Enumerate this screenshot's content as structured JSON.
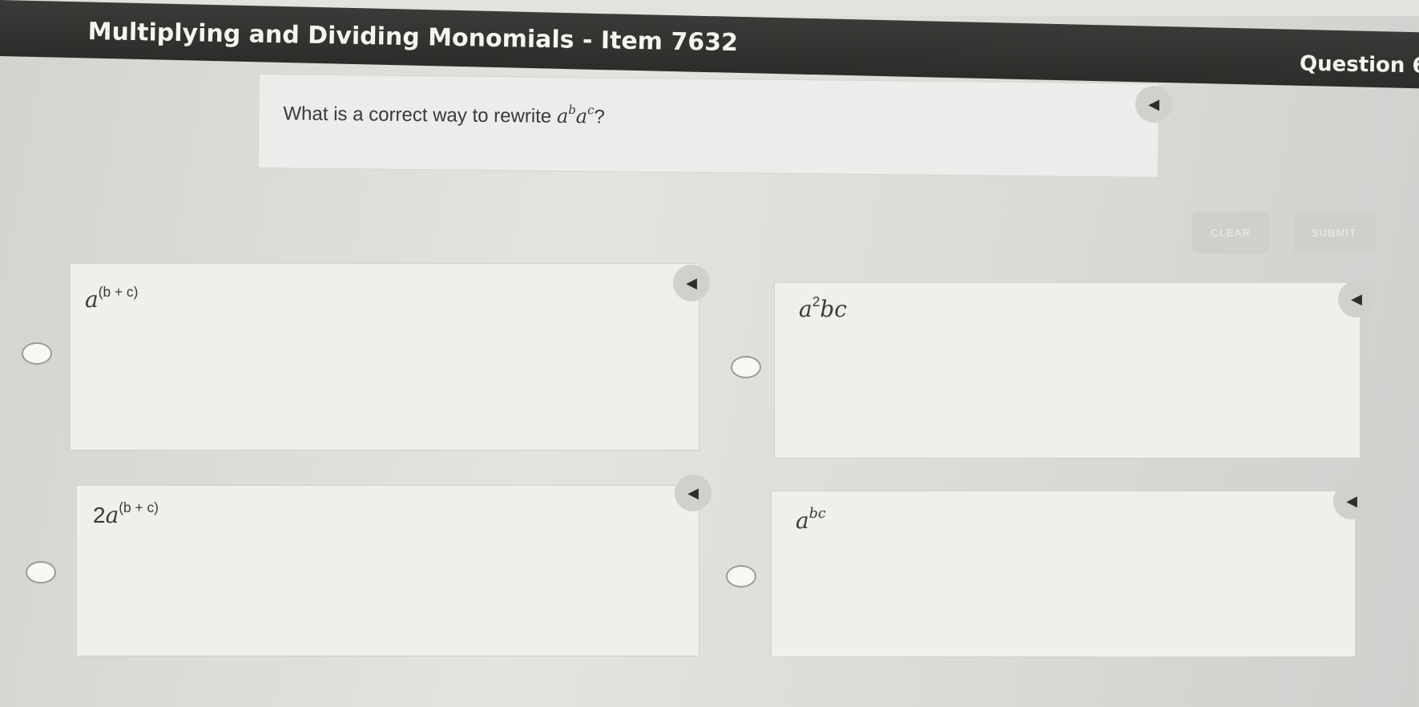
{
  "header": {
    "title": "Multiplying and Dividing Monomials - Item 7632",
    "question_label": "Question 6"
  },
  "question": {
    "prefix": "What is a correct way to rewrite ",
    "base1": "a",
    "exp1": "b",
    "base2": "a",
    "exp2": "c",
    "suffix": "?"
  },
  "buttons": {
    "clear_label": "CLEAR",
    "submit_label": "SUBMIT"
  },
  "choices": [
    {
      "coef": "",
      "base": "a",
      "exp": "(b + c)",
      "rest": ""
    },
    {
      "coef": "",
      "base": "a",
      "exp": "2",
      "rest": "bc"
    },
    {
      "coef": "2",
      "base": "a",
      "exp": "(b + c)",
      "rest": ""
    },
    {
      "coef": "",
      "base": "a",
      "exp": "bc",
      "rest": ""
    }
  ],
  "icons": {
    "speaker": "speaker-icon"
  }
}
